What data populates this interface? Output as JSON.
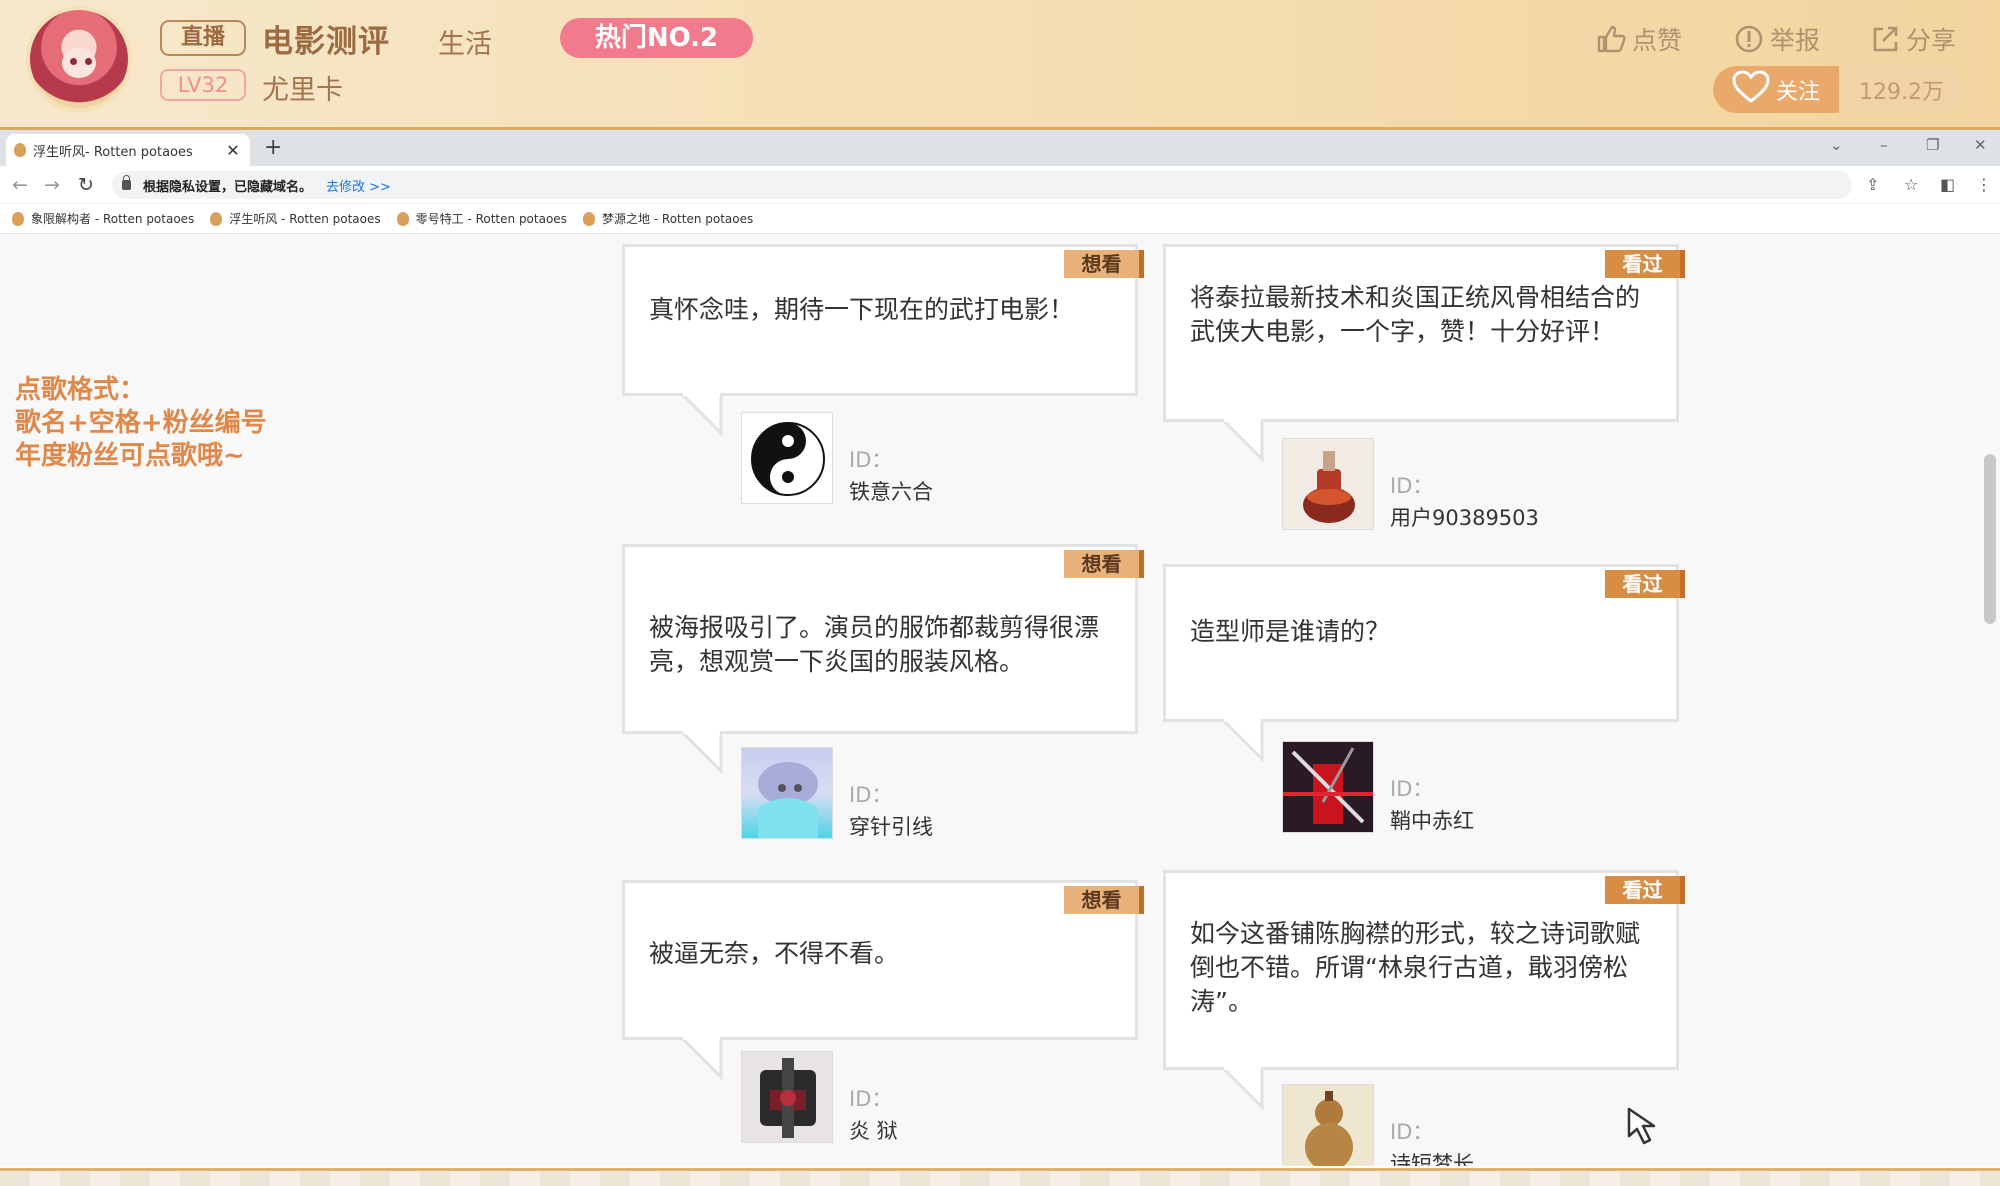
{
  "header": {
    "live_badge": "直播",
    "title": "电影测评",
    "category": "生活",
    "hot_badge": "热门NO.2",
    "level": "LV32",
    "streamer": "尤里卡",
    "like_label": "点赞",
    "report_label": "举报",
    "share_label": "分享",
    "follow_label": "关注",
    "follower_count": "129.2万"
  },
  "browser": {
    "tab_title": "浮生听风- Rotten potaoes",
    "new_tab": "+",
    "privacy_text": "根据隐私设置，已隐藏域名。",
    "modify_link": "去修改 >>",
    "bookmarks": [
      "象限解构者 - Rotten potaoes",
      "浮生听风 - Rotten potaoes",
      "零号特工 - Rotten potaoes",
      "梦源之地 - Rotten potaoes"
    ]
  },
  "sidebar": {
    "line1": "点歌格式：",
    "line2": "歌名+空格+粉丝编号",
    "line3": "年度粉丝可点歌哦~"
  },
  "reviews": [
    {
      "tag": "想看",
      "text": "真怀念哇，期待一下现在的武打电影！",
      "id_label": "ID：",
      "user": "铁意六合"
    },
    {
      "tag": "看过",
      "text": "将泰拉最新技术和炎国正统风骨相结合的武侠大电影，一个字，赞！十分好评！",
      "id_label": "ID：",
      "user": "用户90389503"
    },
    {
      "tag": "想看",
      "text": "被海报吸引了。演员的服饰都裁剪得很漂亮，想观赏一下炎国的服装风格。",
      "id_label": "ID：",
      "user": "穿针引线"
    },
    {
      "tag": "看过",
      "text": "造型师是谁请的？",
      "id_label": "ID：",
      "user": "鞘中赤红"
    },
    {
      "tag": "想看",
      "text": "被逼无奈，不得不看。",
      "id_label": "ID：",
      "user": "炎 狱"
    },
    {
      "tag": "看过",
      "text": "如今这番铺陈胸襟的形式，较之诗词歌赋倒也不错。所谓“林泉行古道，戢羽傍松涛”。",
      "id_label": "ID：",
      "user": "诗短梦长"
    }
  ],
  "colors": {
    "accent": "#9c6b42",
    "hot": "#f17b8d",
    "tag_seen": "#d88d45",
    "tag_want": "#e8b27a",
    "sidebar_text": "#e0884a"
  }
}
